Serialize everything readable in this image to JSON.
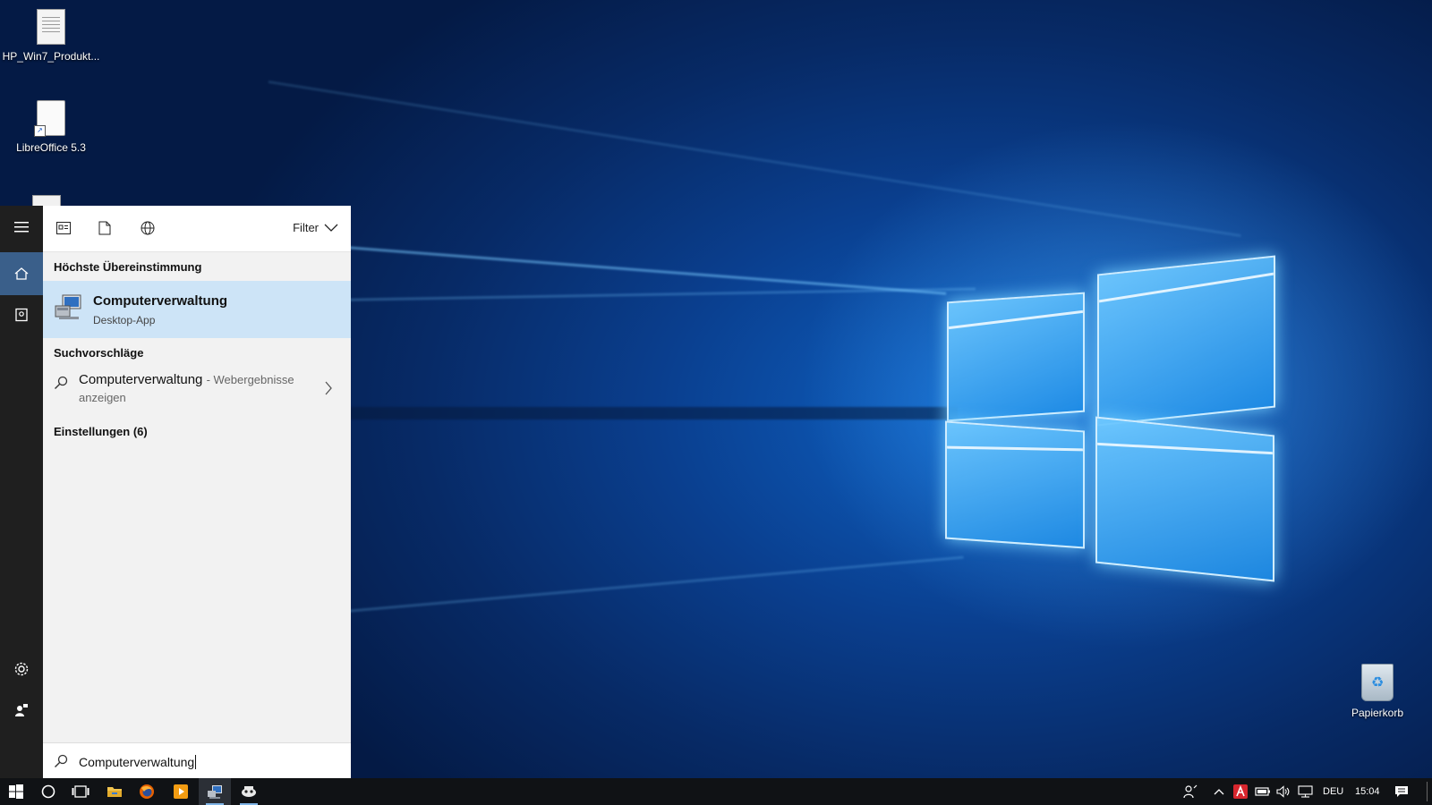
{
  "desktop": {
    "icons": [
      {
        "label": "HP_Win7_Produkt..."
      },
      {
        "label": "LibreOffice 5.3"
      },
      {
        "label": "Papierkorb"
      }
    ]
  },
  "search_panel": {
    "filter_label": "Filter",
    "best_match": {
      "heading": "Höchste Übereinstimmung",
      "title": "Computerverwaltung",
      "subtitle": "Desktop-App"
    },
    "suggestions": {
      "heading": "Suchvorschläge",
      "item_title": "Computerverwaltung",
      "item_hint": "- Webergebnisse",
      "item_hint_line2": "anzeigen"
    },
    "settings_heading": "Einstellungen (6)",
    "search_value": "Computerverwaltung"
  },
  "taskbar": {
    "language": "DEU",
    "time": "15:04"
  },
  "colors": {
    "accent": "#3a5f8a",
    "selection": "#cde4f7",
    "taskbar": "#101215"
  }
}
